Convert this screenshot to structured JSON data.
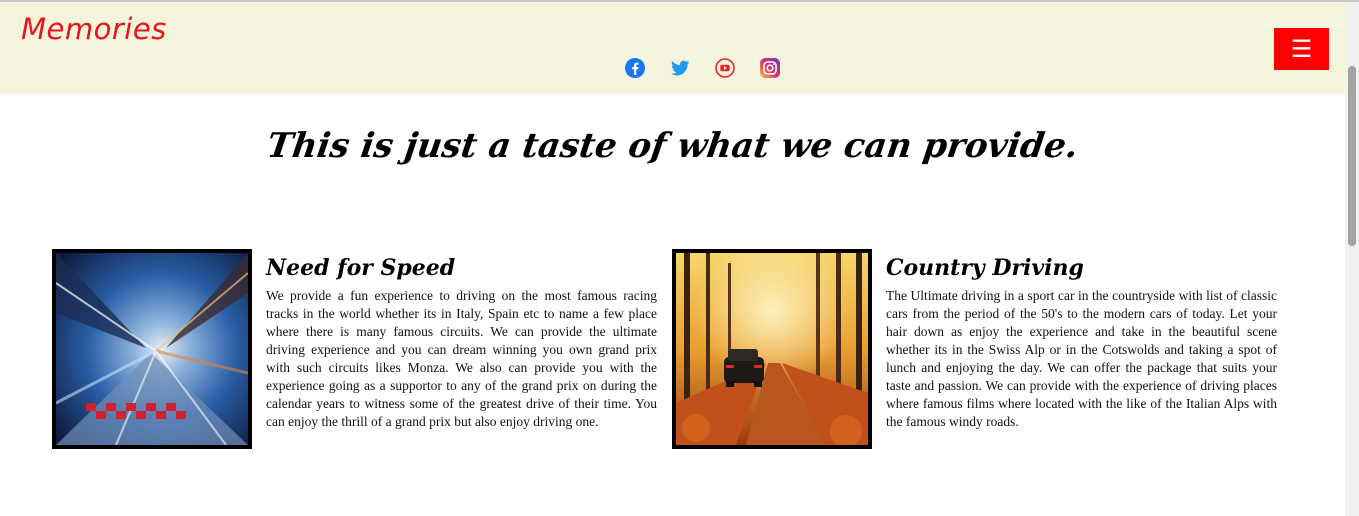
{
  "header": {
    "brand": "Memories",
    "socials": [
      {
        "icon": "facebook-icon"
      },
      {
        "icon": "twitter-icon"
      },
      {
        "icon": "youtube-icon"
      },
      {
        "icon": "instagram-icon"
      }
    ],
    "menu_glyph": "☰"
  },
  "main": {
    "tagline": "This is just a taste of what we can provide.",
    "cards": [
      {
        "title": "Need for Speed",
        "text": "We provide a fun experience to driving on the most famous racing tracks in the world whether its in Italy, Spain etc to name a few place where there is many famous circuits. We can provide the ultimate driving experience and you can dream winning you own grand prix with such circuits likes Monza. We also can provide you with the experience going as a supportor to any of the grand prix on during the calendar years to witness some of the greatest drive of their time. You can enjoy the thrill of a grand prix but also enjoy driving one."
      },
      {
        "title": "Country Driving",
        "text": "The Ultimate driving in a sport car in the countryside with list of classic cars from the period of the 50's to the modern cars of today. Let your hair down as enjoy the experience and take in the beautiful scene whether its in the Swiss Alp or in the Cotswolds and taking a spot of lunch and enjoying the day. We can offer the package that suits your taste and passion. We can provide with the experience of driving places where famous films where located with the like of the Italian Alps with the famous windy roads."
      }
    ]
  },
  "colors": {
    "header_bg": "#f5f4dc",
    "brand": "#e8141b",
    "menu_button": "#ff0000"
  }
}
